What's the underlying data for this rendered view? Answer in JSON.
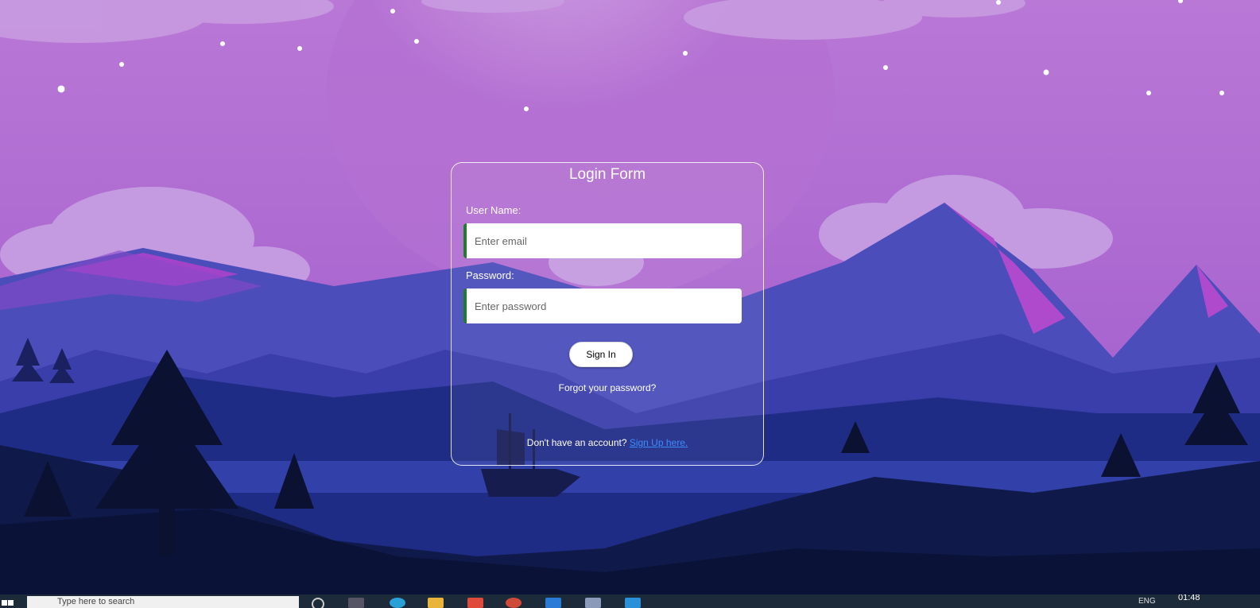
{
  "login": {
    "title": "Login Form",
    "username_label": "User Name:",
    "username_placeholder": "Enter email",
    "password_label": "Password:",
    "password_placeholder": "Enter password",
    "signin_label": "Sign In",
    "forgot_label": "Forgot your password?",
    "signup_prompt": "Don't have an account? ",
    "signup_link": "Sign Up here."
  },
  "taskbar": {
    "search_placeholder": "Type here to search",
    "language": "ENG",
    "time": "01:48"
  },
  "colors": {
    "sky": "#a56cd0",
    "input_accent": "#1e7d2a",
    "link": "#3b8cff"
  }
}
